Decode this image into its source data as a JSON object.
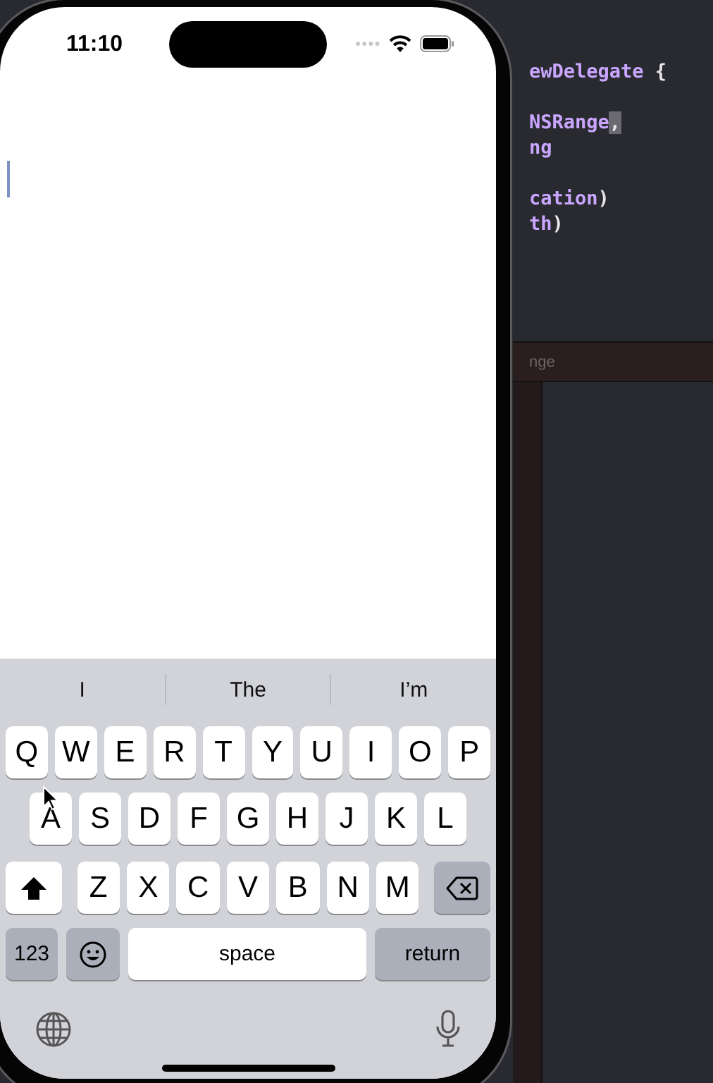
{
  "status_bar": {
    "time": "11:10"
  },
  "keyboard": {
    "suggestions": [
      "I",
      "The",
      "I’m"
    ],
    "rows": [
      [
        "Q",
        "W",
        "E",
        "R",
        "T",
        "Y",
        "U",
        "I",
        "O",
        "P"
      ],
      [
        "A",
        "S",
        "D",
        "F",
        "G",
        "H",
        "J",
        "K",
        "L"
      ],
      [
        "Z",
        "X",
        "C",
        "V",
        "B",
        "N",
        "M"
      ]
    ],
    "number_key": "123",
    "space_key": "space",
    "return_key": "return"
  },
  "editor": {
    "code_blocks": [
      [
        [
          {
            "text": "ewDelegate",
            "kind": "type"
          },
          {
            "text": " {",
            "kind": "plain"
          }
        ]
      ],
      [
        [
          {
            "text": "NSRange",
            "kind": "type"
          },
          {
            "text": ",",
            "kind": "selection"
          }
        ],
        [
          {
            "text": "ng",
            "kind": "type"
          }
        ]
      ],
      [
        [
          {
            "text": "cation",
            "kind": "type"
          },
          {
            "text": ")",
            "kind": "plain"
          }
        ],
        [
          {
            "text": "th",
            "kind": "type"
          },
          {
            "text": ")",
            "kind": "plain"
          }
        ]
      ]
    ],
    "panel_title": "nge"
  }
}
